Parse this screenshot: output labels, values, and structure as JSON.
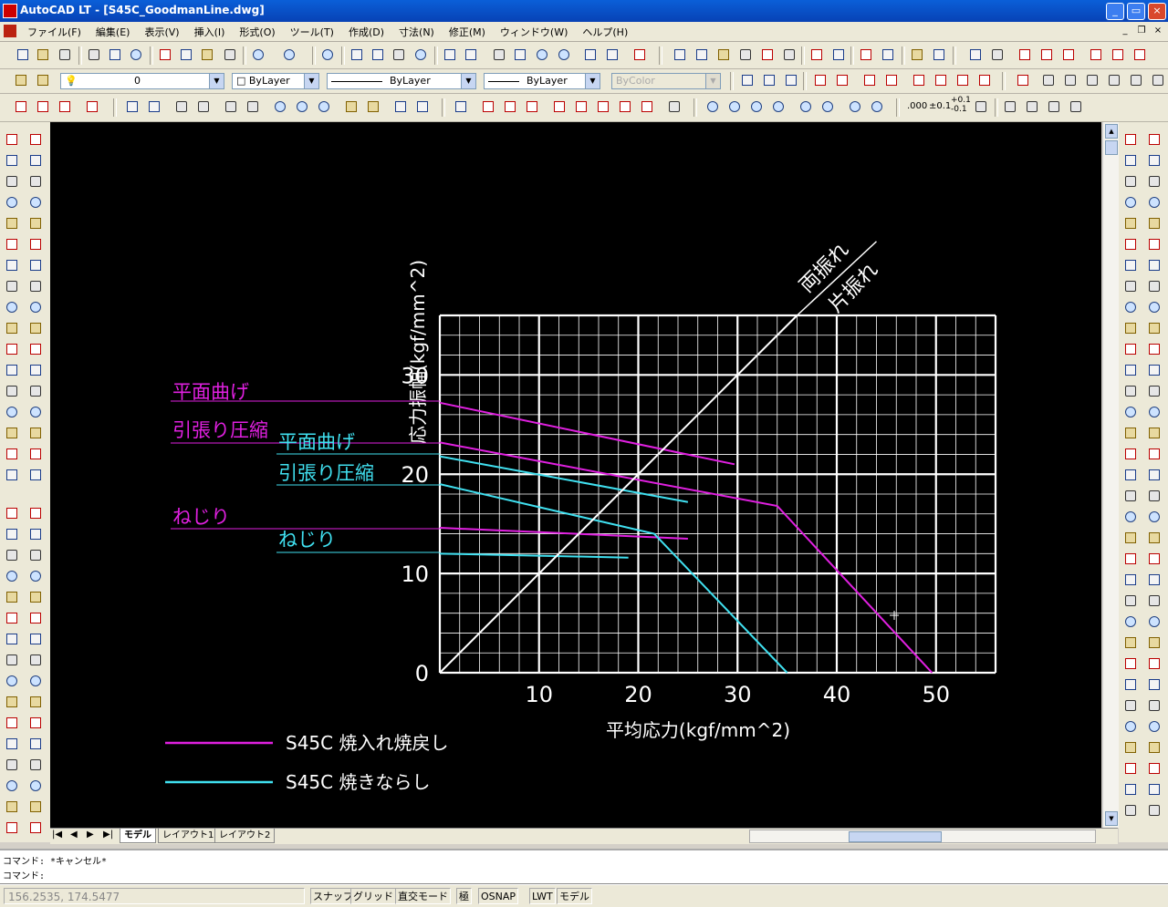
{
  "window": {
    "title": "AutoCAD LT - [S45C_GoodmanLine.dwg]",
    "controls": [
      "_",
      "▭",
      "×"
    ]
  },
  "menu": [
    "ファイル(F)",
    "編集(E)",
    "表示(V)",
    "挿入(I)",
    "形式(O)",
    "ツール(T)",
    "作成(D)",
    "寸法(N)",
    "修正(M)",
    "ウィンドウ(W)",
    "ヘルプ(H)"
  ],
  "toolbar_layers": {
    "layer_value": "0",
    "color_value": "ByLayer",
    "linetype_value": "ByLayer",
    "lineweight_value": "ByLayer",
    "plotstyle_value": "ByColor"
  },
  "dim_precision_labels": [
    ".000",
    "±0.1",
    "+0.1\n-0.1"
  ],
  "drawing": {
    "background": "#000000",
    "grid_color": "#ffffff",
    "y_axis_label": "応力振幅(kgf/mm^2)",
    "x_axis_label": "平均応力(kgf/mm^2)",
    "y_ticks": [
      "0",
      "10",
      "20",
      "30"
    ],
    "x_ticks": [
      "10",
      "20",
      "30",
      "40",
      "50"
    ],
    "diagonal_labels": [
      "両振れ",
      "片振れ"
    ],
    "curve_labels": {
      "magenta": [
        "平面曲げ",
        "引張り圧縮",
        "ねじり"
      ],
      "cyan": [
        "平面曲げ",
        "引張り圧縮",
        "ねじり"
      ]
    },
    "legend": [
      {
        "label": "S45C 焼入れ焼戻し",
        "color": "#e020e0"
      },
      {
        "label": "S45C 焼きならし",
        "color": "#40e0f0"
      }
    ]
  },
  "chart_data": {
    "type": "line",
    "xlabel": "平均応力(kgf/mm^2)",
    "ylabel": "応力振幅(kgf/mm^2)",
    "xlim": [
      0,
      56
    ],
    "ylim": [
      0,
      36
    ],
    "grid": true,
    "series": [
      {
        "name": "平面曲げ",
        "color": "#e020e0",
        "points": [
          [
            0,
            27.2
          ],
          [
            29.7,
            21
          ]
        ]
      },
      {
        "name": "引張り圧縮",
        "color": "#e020e0",
        "points": [
          [
            0,
            23.2
          ],
          [
            34,
            16.8
          ],
          [
            49.6,
            0
          ]
        ]
      },
      {
        "name": "ねじり",
        "color": "#e020e0",
        "points": [
          [
            0,
            14.6
          ],
          [
            25,
            13.5
          ]
        ]
      },
      {
        "name": "平面曲げ",
        "color": "#40e0f0",
        "points": [
          [
            0,
            21.8
          ],
          [
            25,
            17.2
          ]
        ]
      },
      {
        "name": "引張り圧縮",
        "color": "#40e0f0",
        "points": [
          [
            0,
            19
          ],
          [
            21.6,
            14
          ],
          [
            35,
            0
          ]
        ]
      },
      {
        "name": "ねじり",
        "color": "#40e0f0",
        "points": [
          [
            0,
            12
          ],
          [
            19,
            11.6
          ]
        ]
      },
      {
        "color": "#ffffff",
        "points": [
          [
            0,
            0
          ],
          [
            36,
            36
          ]
        ]
      }
    ]
  },
  "tabs": [
    "モデル",
    "レイアウト1",
    "レイアウト2"
  ],
  "command_lines": [
    "コマンド: *キャンセル*",
    "コマンド:"
  ],
  "status": {
    "coords": "156.2535, 174.5477",
    "buttons": [
      "スナップ",
      "グリッド",
      "直交モード",
      "極",
      "OSNAP",
      "LWT",
      "モデル"
    ]
  }
}
